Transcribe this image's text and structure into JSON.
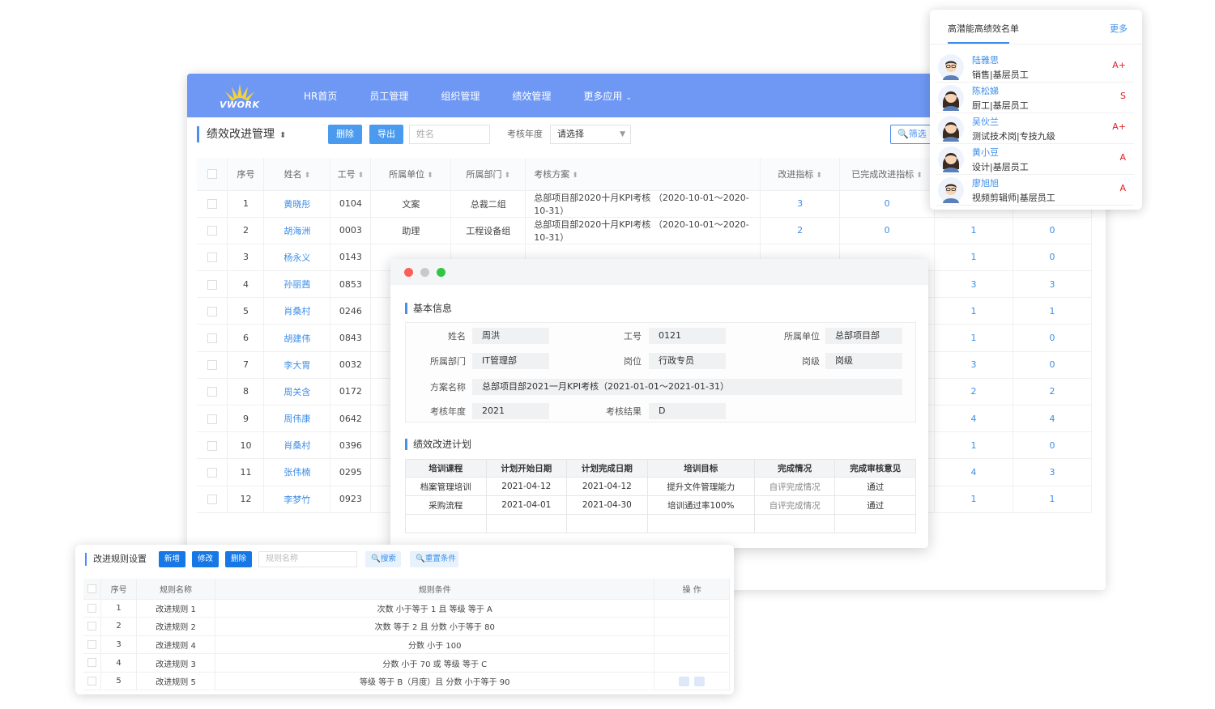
{
  "main": {
    "logo_text": "VWORK",
    "nav": [
      "HR首页",
      "员工管理",
      "组织管理",
      "绩效管理",
      "更多应用"
    ],
    "page_title": "绩效改进管理",
    "delete_label": "删除",
    "export_label": "导出",
    "name_placeholder": "姓名",
    "year_label": "考核年度",
    "year_select": "请选择",
    "filter_label": "筛选",
    "headers": [
      "序号",
      "姓名",
      "工号",
      "所属单位",
      "所属部门",
      "考核方案",
      "改进指标",
      "已完成改进指标"
    ],
    "rows": [
      {
        "no": "1",
        "name": "黄晓彤",
        "id": "0104",
        "unit": "文案",
        "dept": "总裁二组",
        "plan": "总部项目部2020十月KPI考核 （2020-10-01～2020-10-31）",
        "idx": "3",
        "done": "0",
        "c9": "",
        "c10": ""
      },
      {
        "no": "2",
        "name": "胡海洲",
        "id": "0003",
        "unit": "助理",
        "dept": "工程设备组",
        "plan": "总部项目部2020十月KPI考核 （2020-10-01～2020-10-31）",
        "idx": "2",
        "done": "0",
        "c9": "1",
        "c10": "0"
      },
      {
        "no": "3",
        "name": "杨永义",
        "id": "0143",
        "unit": "",
        "dept": "",
        "plan": "",
        "idx": "",
        "done": "",
        "c9": "1",
        "c10": "0"
      },
      {
        "no": "4",
        "name": "孙丽茜",
        "id": "0853",
        "unit": "",
        "dept": "",
        "plan": "",
        "idx": "",
        "done": "",
        "c9": "3",
        "c10": "3"
      },
      {
        "no": "5",
        "name": "肖桑村",
        "id": "0246",
        "unit": "",
        "dept": "",
        "plan": "",
        "idx": "",
        "done": "",
        "c9": "1",
        "c10": "1"
      },
      {
        "no": "6",
        "name": "胡建伟",
        "id": "0843",
        "unit": "",
        "dept": "",
        "plan": "",
        "idx": "",
        "done": "",
        "c9": "1",
        "c10": "0"
      },
      {
        "no": "7",
        "name": "李大胃",
        "id": "0032",
        "unit": "",
        "dept": "",
        "plan": "",
        "idx": "",
        "done": "",
        "c9": "3",
        "c10": "0"
      },
      {
        "no": "8",
        "name": "周关含",
        "id": "0172",
        "unit": "",
        "dept": "",
        "plan": "",
        "idx": "",
        "done": "",
        "c9": "2",
        "c10": "2"
      },
      {
        "no": "9",
        "name": "周伟康",
        "id": "0642",
        "unit": "",
        "dept": "",
        "plan": "",
        "idx": "",
        "done": "",
        "c9": "4",
        "c10": "4"
      },
      {
        "no": "10",
        "name": "肖桑村",
        "id": "0396",
        "unit": "",
        "dept": "",
        "plan": "",
        "idx": "",
        "done": "",
        "c9": "1",
        "c10": "0"
      },
      {
        "no": "11",
        "name": "张伟楠",
        "id": "0295",
        "unit": "",
        "dept": "",
        "plan": "",
        "idx": "",
        "done": "",
        "c9": "4",
        "c10": "3"
      },
      {
        "no": "12",
        "name": "李梦竹",
        "id": "0923",
        "unit": "",
        "dept": "",
        "plan": "",
        "idx": "",
        "done": "",
        "c9": "1",
        "c10": "1"
      }
    ]
  },
  "popup": {
    "title": "高潜能高绩效名单",
    "more": "更多",
    "people": [
      {
        "name": "陆雅思",
        "job": "销售|基层员工",
        "grade": "A+",
        "gender": "m"
      },
      {
        "name": "陈松娣",
        "job": "厨工|基层员工",
        "grade": "S",
        "gender": "f"
      },
      {
        "name": "吴伙兰",
        "job": "测试技术岗|专技九级",
        "grade": "A+",
        "gender": "f"
      },
      {
        "name": "黄小豆",
        "job": "设计|基层员工",
        "grade": "A",
        "gender": "f"
      },
      {
        "name": "廖旭旭",
        "job": "视频剪辑师|基层员工",
        "grade": "A",
        "gender": "m"
      }
    ]
  },
  "modal": {
    "basic_title": "基本信息",
    "name_label": "姓名",
    "name_value": "周洪",
    "id_label": "工号",
    "id_value": "0121",
    "unit_label": "所属单位",
    "unit_value": "总部项目部",
    "dept_label": "所属部门",
    "dept_value": "IT管理部",
    "post_label": "岗位",
    "post_value": "行政专员",
    "level_label": "岗级",
    "level_value": "岗级",
    "scheme_label": "方案名称",
    "scheme_value": "总部项目部2021一月KPI考核（2021-01-01～2021-01-31）",
    "year_label": "考核年度",
    "year_value": "2021",
    "result_label": "考核结果",
    "result_value": "D",
    "plan_title": "绩效改进计划",
    "plan_headers": [
      "培训课程",
      "计划开始日期",
      "计划完成日期",
      "培训目标",
      "完成情况",
      "完成审核意见"
    ],
    "plan_rows": [
      [
        "档案管理培训",
        "2021-04-12",
        "2021-04-12",
        "提升文件管理能力",
        "自评完成情况",
        "通过"
      ],
      [
        "采购流程",
        "2021-04-01",
        "2021-04-30",
        "培训通过率100%",
        "自评完成情况",
        "通过"
      ]
    ]
  },
  "rules": {
    "title": "改进规则设置",
    "new_label": "新增",
    "edit_label": "修改",
    "delete_label": "删除",
    "name_placeholder": "规则名称",
    "search_label": "搜索",
    "reset_label": "重置条件",
    "headers": [
      "序号",
      "规则名称",
      "规则条件",
      "操 作"
    ],
    "rows": [
      {
        "no": "1",
        "name": "改进规则 1",
        "cond": "次数 小于等于 1 且 等级 等于 A"
      },
      {
        "no": "2",
        "name": "改进规则 2",
        "cond": "次数 等于 2 且 分数 小于等于 80"
      },
      {
        "no": "3",
        "name": "改进规则 4",
        "cond": "分数 小于 100"
      },
      {
        "no": "4",
        "name": "改进规则 3",
        "cond": "分数 小于 70 或 等级 等于 C"
      },
      {
        "no": "5",
        "name": "改进规则 5",
        "cond": "等级 等于 B（月度）且 分数 小于等于 90"
      }
    ]
  },
  "colors": {
    "nav_bg": "#6e98f4",
    "link": "#3d8ee8",
    "grade": "#e02020",
    "button": "#4a9bf0"
  }
}
